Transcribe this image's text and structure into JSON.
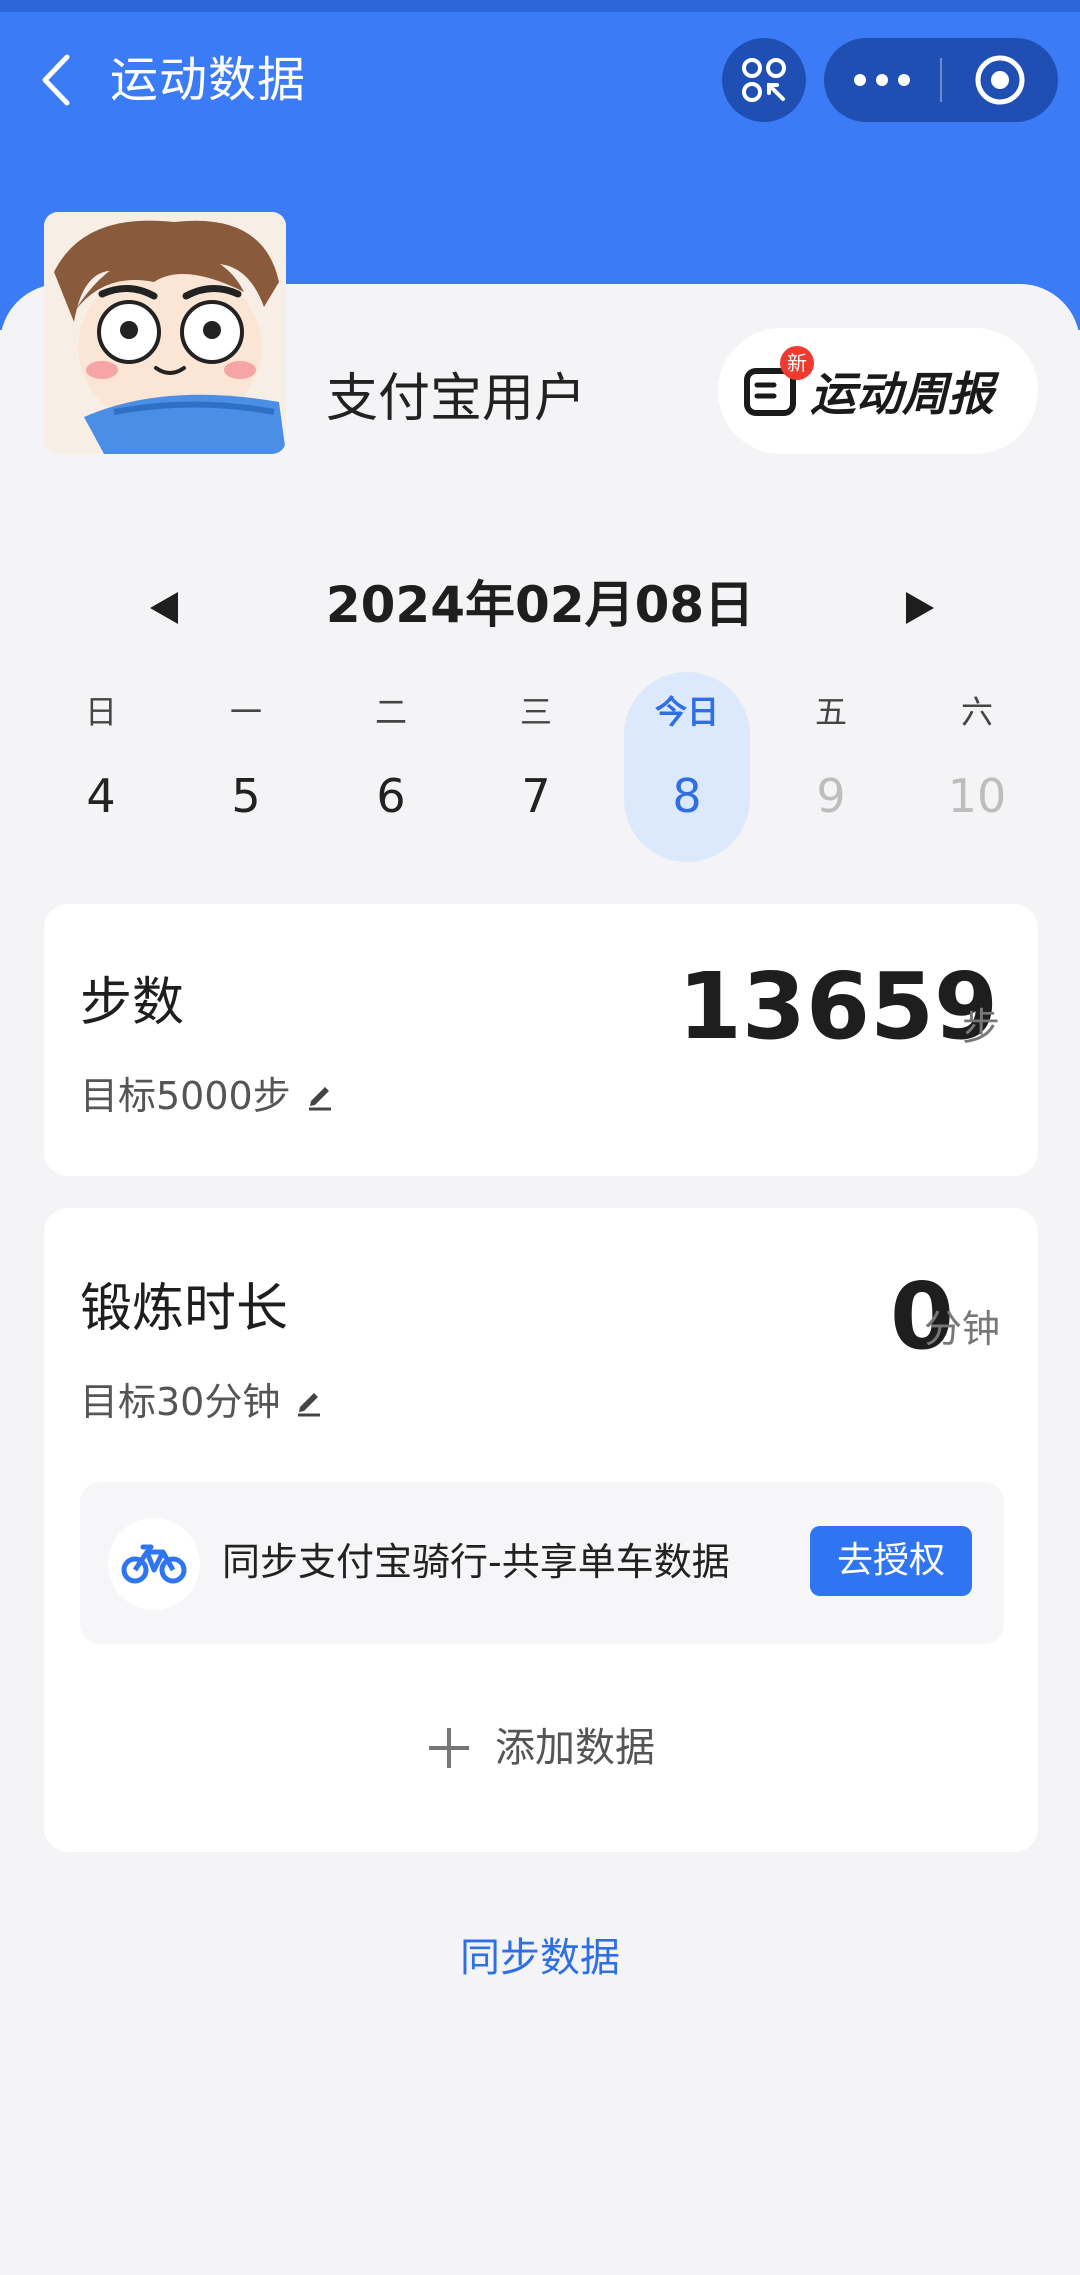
{
  "header": {
    "title": "运动数据",
    "back_icon": "chevron-left-icon",
    "scan_icon": "scan-icon",
    "more_icon": "more-dots-icon",
    "close_icon": "target-close-icon",
    "bg_color": "#3b7bf5"
  },
  "profile": {
    "username": "支付宝用户",
    "avatar_icon": "cartoon-avatar"
  },
  "weekly_report": {
    "label": "运动周报",
    "badge": "新",
    "icon": "report-doc-icon"
  },
  "date_nav": {
    "current_date": "2024年02月08日",
    "prev_icon": "triangle-left-icon",
    "next_icon": "triangle-right-icon"
  },
  "week": [
    {
      "weekday": "日",
      "day": "4",
      "state": "past"
    },
    {
      "weekday": "一",
      "day": "5",
      "state": "past"
    },
    {
      "weekday": "二",
      "day": "6",
      "state": "past"
    },
    {
      "weekday": "三",
      "day": "7",
      "state": "past"
    },
    {
      "weekday": "今日",
      "day": "8",
      "state": "active"
    },
    {
      "weekday": "五",
      "day": "9",
      "state": "future"
    },
    {
      "weekday": "六",
      "day": "10",
      "state": "future"
    }
  ],
  "steps_card": {
    "title": "步数",
    "value": "13659",
    "unit": "步",
    "goal": "目标5000步",
    "edit_icon": "pencil-icon"
  },
  "exercise_card": {
    "title": "锻炼时长",
    "value": "0",
    "unit": "分钟",
    "goal": "目标30分钟",
    "edit_icon": "pencil-icon",
    "sync_item": {
      "icon": "bicycle-icon",
      "text": "同步支付宝骑行-共享单车数据",
      "button": "去授权"
    },
    "add_data": {
      "icon": "plus-icon",
      "label": "添加数据"
    }
  },
  "footer": {
    "sync_link": "同步数据"
  },
  "colors": {
    "accent": "#2f6fe6",
    "button": "#2f74f0",
    "badge": "#ee3a2f"
  }
}
